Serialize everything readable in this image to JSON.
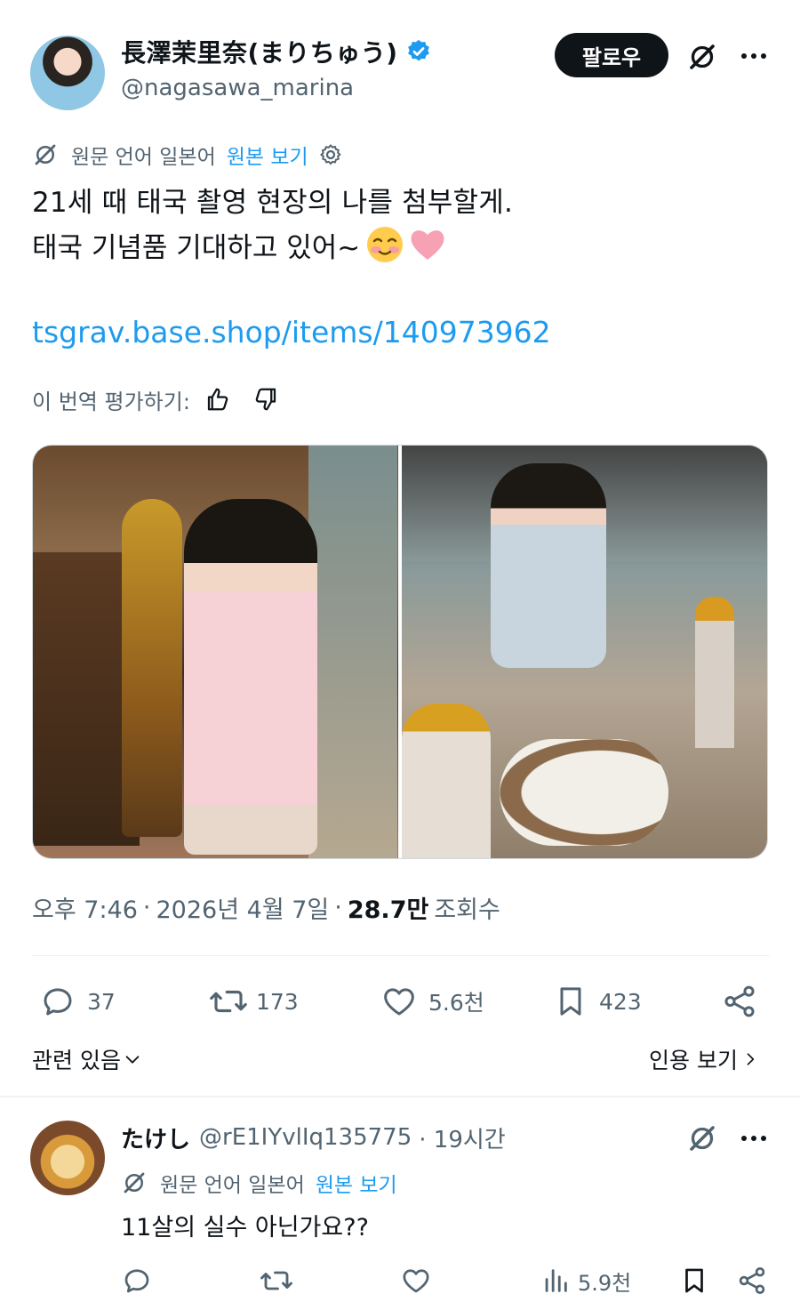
{
  "post": {
    "author": {
      "display_name": "長澤茉里奈(まりちゅう)",
      "handle": "@nagasawa_marina",
      "verified": true
    },
    "follow_label": "팔로우",
    "translation": {
      "source_label": "원문 언어 일본어",
      "show_original": "원본 보기"
    },
    "text_line1": "21세 때 태국 촬영 현장의 나를 첨부할게.",
    "text_line2": "태국 기념품 기대하고 있어~",
    "link": "tsgrav.base.shop/items/140973962",
    "rate_translation": "이 번역 평가하기:",
    "meta": {
      "time": "오후 7:46",
      "separator": "·",
      "date": "2026년 4월 7일",
      "views_count": "28.7만",
      "views_label": "조회수"
    },
    "actions": {
      "replies": "37",
      "reposts": "173",
      "likes": "5.6천",
      "bookmarks": "423"
    },
    "related_label": "관련 있음",
    "quotes_label": "인용 보기"
  },
  "reply": {
    "author": "たけし",
    "handle": "@rE1IYvlIq135775",
    "time": "· 19시간",
    "translation_source": "원문 언어 일본어",
    "show_original": "원본 보기",
    "text": "11살의 실수 아닌가요??",
    "views": "5.9천"
  },
  "colors": {
    "accent": "#1d9bf0",
    "text": "#0f1419",
    "muted": "#536471",
    "follow_bg": "#0f1419",
    "divider": "#eff3f4"
  }
}
